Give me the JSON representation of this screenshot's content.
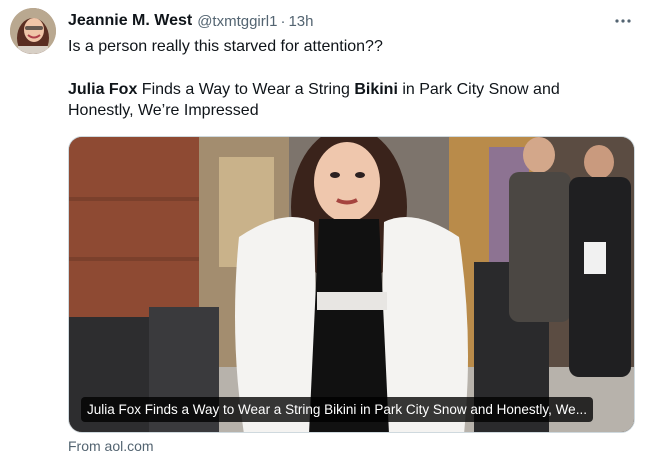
{
  "author": {
    "name": "Jeannie M. West",
    "handle": "@txmtggirl1",
    "separator": "·",
    "time": "13h"
  },
  "tweet": {
    "line1": "Is a person really this starved for attention??",
    "headline": {
      "part1": "Julia Fox",
      "part2": " Finds a Way to Wear a String ",
      "part3": "Bikini",
      "part4": " in Park City Snow and Honestly, We’re Impressed"
    }
  },
  "card": {
    "caption": "Julia Fox Finds a Way to Wear a String Bikini in Park City Snow and Honestly, We...",
    "source": "From aol.com"
  },
  "icons": {
    "more": "more-horizontal-icon",
    "avatar": "avatar"
  },
  "colors": {
    "text": "#0f1419",
    "secondary": "#536471",
    "border": "#cfd9de"
  }
}
